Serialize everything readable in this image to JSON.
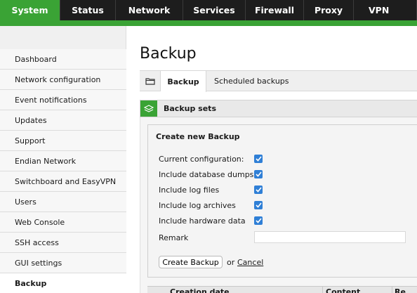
{
  "topnav": {
    "tabs": [
      {
        "label": "System",
        "active": true
      },
      {
        "label": "Status",
        "active": false
      },
      {
        "label": "Network",
        "active": false
      },
      {
        "label": "Services",
        "active": false
      },
      {
        "label": "Firewall",
        "active": false
      },
      {
        "label": "Proxy",
        "active": false
      },
      {
        "label": "VPN",
        "active": false
      }
    ]
  },
  "sidebar": {
    "items": [
      {
        "label": "Dashboard"
      },
      {
        "label": "Network configuration"
      },
      {
        "label": "Event notifications"
      },
      {
        "label": "Updates"
      },
      {
        "label": "Support"
      },
      {
        "label": "Endian Network"
      },
      {
        "label": "Switchboard and EasyVPN"
      },
      {
        "label": "Users"
      },
      {
        "label": "Web Console"
      },
      {
        "label": "SSH access"
      },
      {
        "label": "GUI settings"
      },
      {
        "label": "Backup",
        "active": true
      }
    ]
  },
  "main": {
    "title": "Backup",
    "tabs": [
      {
        "label": "Backup",
        "active": true
      },
      {
        "label": "Scheduled backups",
        "active": false
      }
    ],
    "section_title": "Backup sets",
    "form": {
      "title": "Create new Backup",
      "options": [
        {
          "label": "Current configuration:",
          "checked": true
        },
        {
          "label": "Include database dumps",
          "checked": true
        },
        {
          "label": "Include log files",
          "checked": true
        },
        {
          "label": "Include log archives",
          "checked": true
        },
        {
          "label": "Include hardware data",
          "checked": true
        }
      ],
      "remark_label": "Remark",
      "remark_value": "",
      "create_label": "Create Backup",
      "or_text": "or",
      "cancel_label": "Cancel"
    },
    "table": {
      "headers": [
        "Creation date",
        "Content",
        "Re"
      ]
    }
  },
  "colors": {
    "accent": "#3aa335",
    "nav_bg": "#1d1d1d",
    "checkbox": "#2f7fd6"
  }
}
